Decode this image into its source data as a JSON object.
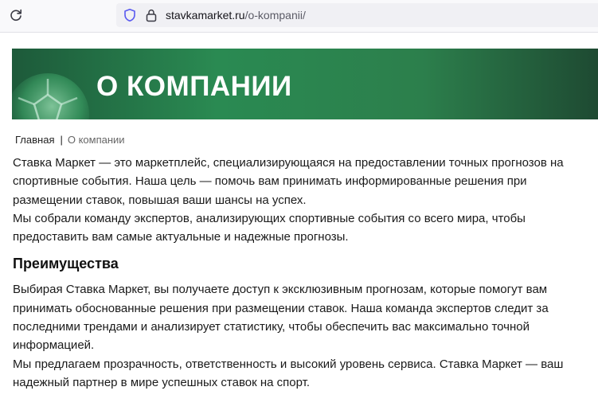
{
  "browser": {
    "url_host": "stavkamarket.ru",
    "url_path": "/o-kompanii/"
  },
  "colors": {
    "banner_green": "#2a8a52",
    "text": "#1a1a1a",
    "breadcrumb_current": "#666666"
  },
  "icons": {
    "reload": "reload-icon",
    "tracking": "shield-icon",
    "security": "lock-icon"
  },
  "banner": {
    "title": "О КОМПАНИИ"
  },
  "breadcrumb": {
    "home": "Главная",
    "separator": "|",
    "current": "О компании"
  },
  "content": {
    "intro": [
      "Ставка Маркет — это маркетплейс, специализирующаяся на предоставлении точных прогнозов на спортивные события. Наша цель — помочь вам принимать информированные решения при размещении ставок, повышая ваши шансы на успех.",
      "Мы собрали команду экспертов, анализирующих спортивные события со всего мира, чтобы предоставить вам самые актуальные и надежные прогнозы."
    ],
    "advantages_heading": "Преимущества",
    "advantages": [
      "Выбирая Ставка Маркет, вы получаете доступ к эксклюзивным прогнозам, которые помогут вам принимать обоснованные решения при размещении ставок. Наша команда экспертов следит за последними трендами и анализирует статистику, чтобы обеспечить вас максимально точной информацией.",
      "Мы предлагаем прозрачность, ответственность и высокий уровень сервиса. Ставка Маркет — ваш надежный партнер в мире успешных ставок на спорт."
    ]
  }
}
